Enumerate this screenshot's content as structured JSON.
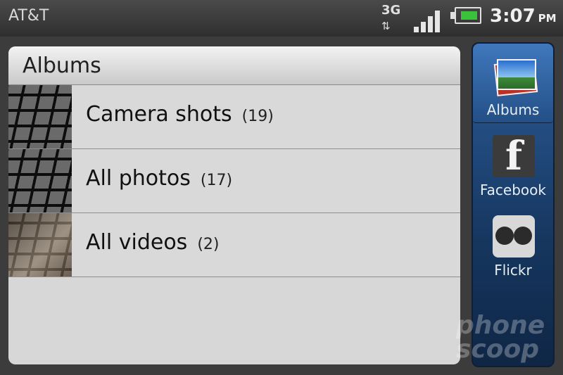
{
  "status_bar": {
    "carrier": "AT&T",
    "network": "3G",
    "network_arrows": "⇅",
    "signal_bars": 4,
    "battery_level": 0.75,
    "time": "3:07",
    "ampm": "PM"
  },
  "albums_panel": {
    "title": "Albums",
    "items": [
      {
        "label": "Camera shots",
        "count": "(19)"
      },
      {
        "label": "All photos",
        "count": "(17)"
      },
      {
        "label": "All videos",
        "count": "(2)"
      }
    ]
  },
  "sources": [
    {
      "label": "Albums",
      "icon": "albums-icon",
      "selected": true
    },
    {
      "label": "Facebook",
      "icon": "facebook-icon",
      "selected": false
    },
    {
      "label": "Flickr",
      "icon": "flickr-icon",
      "selected": false
    }
  ],
  "watermark": {
    "line1": "phone",
    "line2": "scoop"
  },
  "colors": {
    "accent": "#2d5e9b",
    "battery": "#39c23a"
  }
}
